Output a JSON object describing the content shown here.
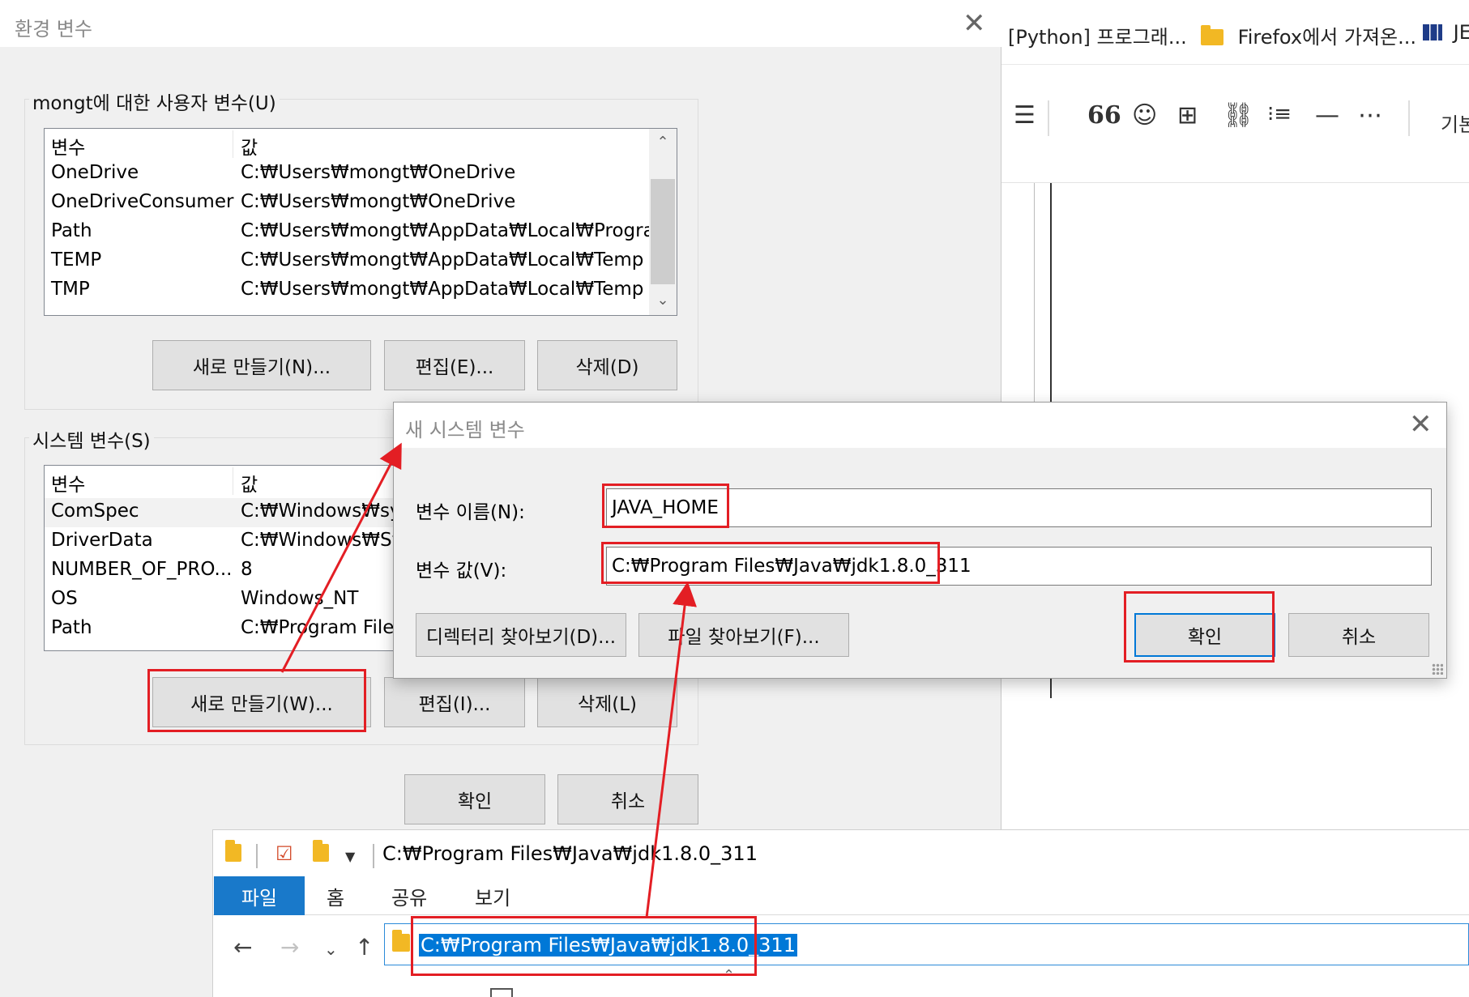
{
  "browser": {
    "bookmarks": [
      "[Python] 프로그래...",
      "Firefox에서 가져온...",
      "JE"
    ],
    "toolbar_icons": [
      "align-icon",
      "quote-icon",
      "emoji-icon",
      "table-icon",
      "link-icon",
      "list-icon",
      "divider-icon",
      "more-icon"
    ],
    "toolbar_tail_label": "기본"
  },
  "env_dialog": {
    "title": "환경 변수",
    "user_group_label": "mongt에 대한 사용자 변수(U)",
    "user_columns": [
      "변수",
      "값"
    ],
    "user_vars": [
      {
        "name": "OneDrive",
        "value": "C:₩Users₩mongt₩OneDrive"
      },
      {
        "name": "OneDriveConsumer",
        "value": "C:₩Users₩mongt₩OneDrive"
      },
      {
        "name": "Path",
        "value": "C:₩Users₩mongt₩AppData₩Local₩Program..."
      },
      {
        "name": "TEMP",
        "value": "C:₩Users₩mongt₩AppData₩Local₩Temp"
      },
      {
        "name": "TMP",
        "value": "C:₩Users₩mongt₩AppData₩Local₩Temp"
      }
    ],
    "user_buttons": {
      "new": "새로 만들기(N)...",
      "edit": "편집(E)...",
      "delete": "삭제(D)"
    },
    "system_group_label": "시스템 변수(S)",
    "system_columns": [
      "변수",
      "값"
    ],
    "system_vars": [
      {
        "name": "ComSpec",
        "value": "C:₩Windows₩syst"
      },
      {
        "name": "DriverData",
        "value": "C:₩Windows₩Sys"
      },
      {
        "name": "NUMBER_OF_PRO...",
        "value": "8"
      },
      {
        "name": "OS",
        "value": "Windows_NT"
      },
      {
        "name": "Path",
        "value": "C:₩Program Files"
      }
    ],
    "system_buttons": {
      "new": "새로 만들기(W)...",
      "edit": "편집(I)...",
      "delete": "삭제(L)"
    },
    "ok": "확인",
    "cancel": "취소"
  },
  "new_var_dialog": {
    "title": "새 시스템 변수",
    "name_label": "변수 이름(N):",
    "name_value": "JAVA_HOME",
    "value_label": "변수 값(V):",
    "value_value": "C:₩Program Files₩Java₩jdk1.8.0_311",
    "browse_dir": "디렉터리 찾아보기(D)...",
    "browse_file": "파일 찾아보기(F)...",
    "ok": "확인",
    "cancel": "취소"
  },
  "explorer": {
    "title_path": "C:₩Program Files₩Java₩jdk1.8.0_311",
    "tabs": [
      "파일",
      "홈",
      "공유",
      "보기"
    ],
    "address": "C:₩Program Files₩Java₩jdk1.8.0_311"
  },
  "colors": {
    "annotation": "#e31e24",
    "accent": "#0078d7",
    "ribbon_active": "#1979ca"
  }
}
